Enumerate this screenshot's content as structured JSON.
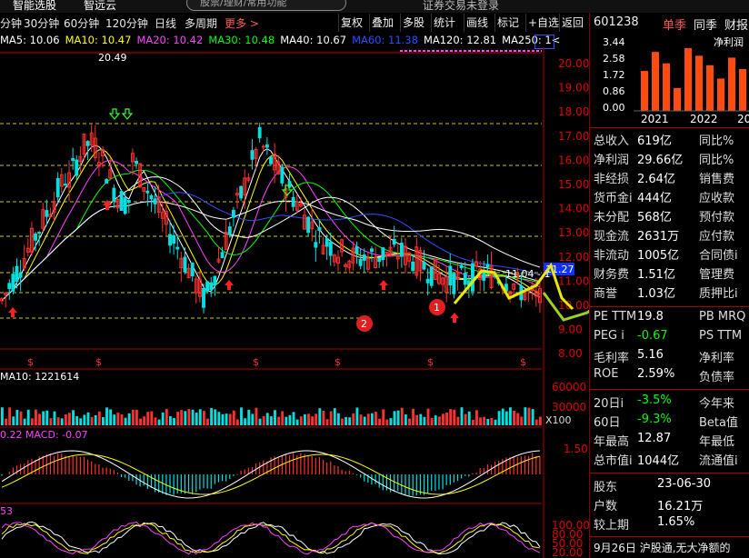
{
  "top": {
    "item1": "智能选股",
    "item2": "智远云",
    "search_placeholder": "股票/理财/常用功能",
    "login": "证券交易未登录"
  },
  "periods": [
    {
      "label": "分钟",
      "active": false
    },
    {
      "label": "30分钟",
      "active": false
    },
    {
      "label": "60分钟",
      "active": false
    },
    {
      "label": "120分钟",
      "active": false
    },
    {
      "label": "日线",
      "active": false
    },
    {
      "label": "多周期",
      "active": false
    },
    {
      "label": "更多 >",
      "active": true
    }
  ],
  "toolbar": {
    "fuquan": "复权",
    "diejia": "叠加",
    "duogu": "多股",
    "tongji": "统计",
    "huaxian": "画线",
    "biaoji": "标记",
    "zixuan": "+自选",
    "fanhui": "返回"
  },
  "ma_legend": [
    {
      "text": "MA5: 10.06",
      "color": "#ffffff"
    },
    {
      "text": "MA10: 10.47",
      "color": "#ffff00"
    },
    {
      "text": "MA20: 10.42",
      "color": "#ff40ff"
    },
    {
      "text": "MA30: 10.48",
      "color": "#00ff00"
    },
    {
      "text": "MA40: 10.67",
      "color": "#ffffff"
    },
    {
      "text": "MA60: 11.38",
      "color": "#3050ff"
    },
    {
      "text": "MA120: 12.81",
      "color": "#ffffff"
    },
    {
      "text": "MA250: 1<",
      "color": "#ffffff"
    }
  ],
  "price_axis": [
    "20.00",
    "19.00",
    "18.00",
    "17.00",
    "16.00",
    "15.00",
    "14.00",
    "13.00",
    "12.00",
    "11.00",
    "10.00",
    "9.00",
    "8.00"
  ],
  "vol_axis": [
    "60000",
    "30000"
  ],
  "vol_unit": "X100",
  "vol_legend": "MA10: 1221614",
  "macd_legend": "0.22  MACD: -0.07",
  "macd_axis": [
    "1.50"
  ],
  "kdj_legend": "53",
  "kdj_axis": [
    "100.00",
    "80.00",
    "50.00",
    "20.00"
  ],
  "annotations": {
    "high": "20.49",
    "current_price": "11.27",
    "line_label": "11.04 - 1",
    "badge1": "1",
    "badge2": "2"
  },
  "right_panel": {
    "code": "601238",
    "tab1": "单季",
    "tab2": "同季",
    "tab3": "财报",
    "chart_title": "净利润",
    "y_axis": [
      "3.44",
      "2.58",
      "1.72",
      "0.86",
      "0.00"
    ],
    "years": [
      "2021",
      "2022",
      "20"
    ],
    "bars": [
      2.1,
      3.1,
      2.5,
      1.2,
      3.3,
      2.9,
      2.4,
      1.7,
      2.8,
      2.2
    ],
    "rows": [
      {
        "l1": "总收入",
        "v1": "619亿",
        "l2": "同比%",
        "v2": ""
      },
      {
        "l1": "净利润",
        "v1": "29.66亿",
        "l2": "同比%",
        "v2": ""
      },
      {
        "l1": "非经损",
        "v1": "2.64亿",
        "l2": "销售费",
        "v2": "2"
      },
      {
        "l1": "货币金i",
        "v1": "444亿",
        "l2": "应收款",
        "v2": "8"
      },
      {
        "l1": "未分配",
        "v1": "568亿",
        "l2": "预付款",
        "v2": "1"
      },
      {
        "l1": "现金流",
        "v1": "2631万",
        "l2": "应付款",
        "v2": ""
      },
      {
        "l1": "非流动",
        "v1": "1005亿",
        "l2": "合同债i",
        "v2": "4"
      },
      {
        "l1": "财务费",
        "v1": "1.51亿",
        "l2": "管理费",
        "v2": "1"
      },
      {
        "l1": "商誉",
        "v1": "1.03亿",
        "l2": "质押比i",
        "v2": ""
      }
    ],
    "val_rows": [
      {
        "l1": "PE TTM",
        "v1": "19.8",
        "l2": "PB MRQ",
        "v2": ""
      },
      {
        "l1": "PEG i",
        "v1": "-0.67",
        "l2": "PS TTM",
        "v2": ""
      },
      {
        "l1": "毛利率",
        "v1": "5.16",
        "l2": "净利率",
        "v2": ""
      },
      {
        "l1": "ROE",
        "v1": "2.59%",
        "l2": "负债率",
        "v2": ""
      }
    ],
    "perf_rows": [
      {
        "l1": "20日i",
        "v1": "-3.5%",
        "l2": "今年来",
        "v2": ""
      },
      {
        "l1": "60日",
        "v1": "-9.3%",
        "l2": "Beta值",
        "v2": ""
      },
      {
        "l1": "年最高",
        "v1": "12.87",
        "l2": "年最低",
        "v2": ""
      },
      {
        "l1": "总市值i",
        "v1": "1044亿",
        "l2": "流通值i",
        "v2": ""
      }
    ],
    "holder_rows": [
      {
        "l1": "股东",
        "v1": "23-06-30"
      },
      {
        "l1": "户数",
        "v1": "16.21万"
      },
      {
        "l1": "较上期",
        "v1": "1.65%"
      }
    ],
    "news": "9月26日 沪股通,无大净额的"
  }
}
